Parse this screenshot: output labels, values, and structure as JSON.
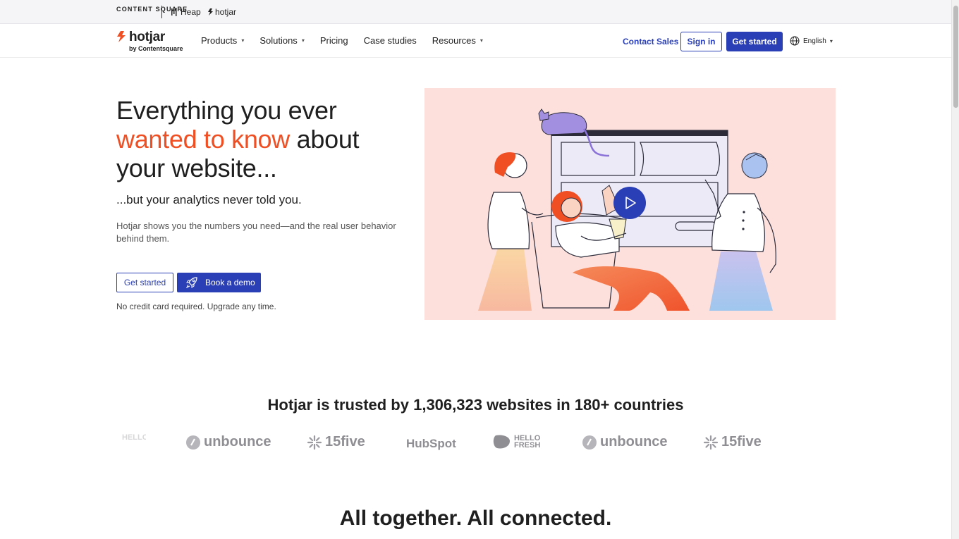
{
  "topbar": {
    "brand_contentsquare": "CONTENT SQUARE",
    "brand_heap": "Heap",
    "brand_hotjar": "hotjar"
  },
  "navbar": {
    "logo_text": "hotjar",
    "logo_sub": "by Contentsquare",
    "items": [
      {
        "label": "Products",
        "has_caret": true
      },
      {
        "label": "Solutions",
        "has_caret": true
      },
      {
        "label": "Pricing",
        "has_caret": false
      },
      {
        "label": "Case studies",
        "has_caret": false
      },
      {
        "label": "Resources",
        "has_caret": true
      }
    ],
    "contact_label": "Contact Sales",
    "signin_label": "Sign in",
    "get_started_label": "Get started",
    "language_label": "English"
  },
  "hero": {
    "title_line1": "Everything you ever",
    "title_accent": "wanted to know",
    "title_after_accent": " about",
    "title_line3": "your website...",
    "subtitle": "...but your analytics never told you.",
    "description": "Hotjar shows you the numbers you need—and the real user behavior behind them.",
    "cta_start": "Get started",
    "cta_demo": "Book a demo",
    "note": "No credit card required. Upgrade any time."
  },
  "trusted": {
    "headline": "Hotjar is trusted by 1,306,323 websites in 180+ countries",
    "logos": [
      "HELLO FRESH",
      "unbounce",
      "15five",
      "HubSpot",
      "HELLO FRESH",
      "unbounce",
      "15five"
    ]
  },
  "together": {
    "headline": "All together. All connected."
  },
  "colors": {
    "brand_blue": "#2a3fb5",
    "accent_orange": "#f04e23",
    "hero_bg": "#fde0dc"
  }
}
